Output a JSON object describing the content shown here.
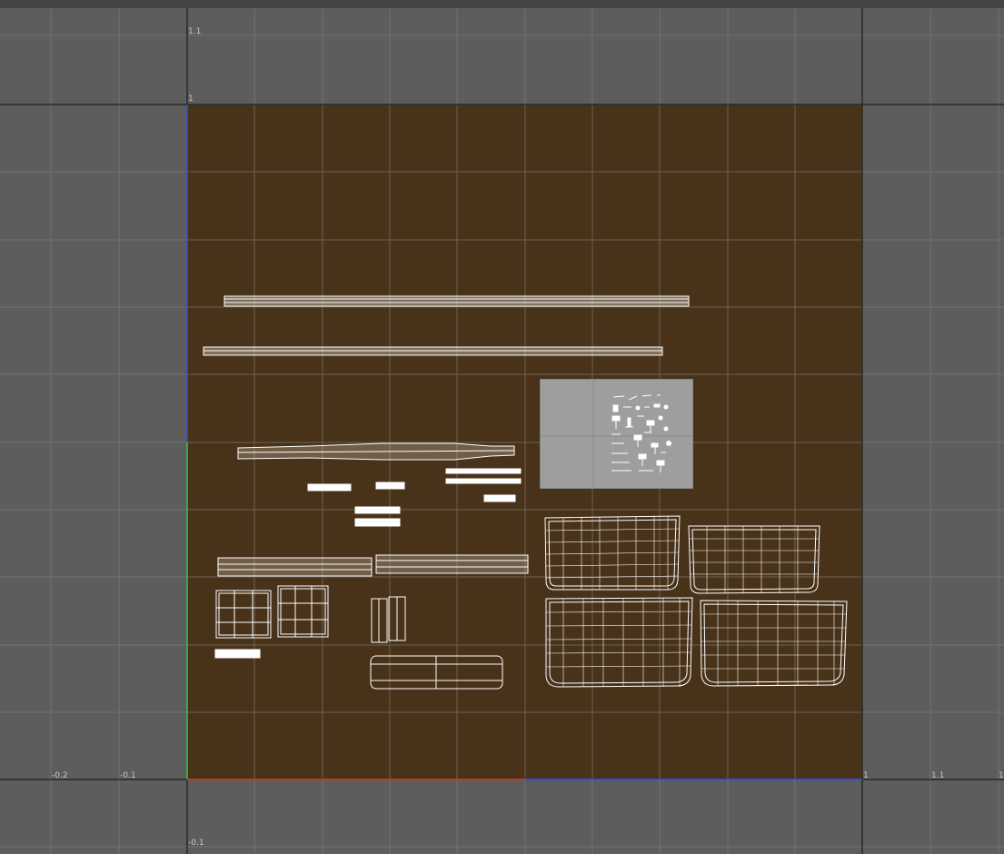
{
  "app": {
    "panel": "UV Editor"
  },
  "axis": {
    "x_ticks": [
      "-0.2",
      "-0.1",
      "1",
      "1.1",
      "1"
    ],
    "y_ticks": [
      "1.1",
      "1",
      "-0.1"
    ]
  },
  "colors": {
    "viewport_bg": "#5d5d5d",
    "uv_tile": "#48321a",
    "grid_line": "#7a7a7a",
    "tile_grid_line": "#6b5a44",
    "wireframe": "#ffffff",
    "u_axis": "#c0392b",
    "v_axis": "#2ecc40",
    "boundary_blue": "#3a4bd6",
    "swatch": "#9e9e9e"
  },
  "shells": {
    "count_description_hidden": true
  }
}
